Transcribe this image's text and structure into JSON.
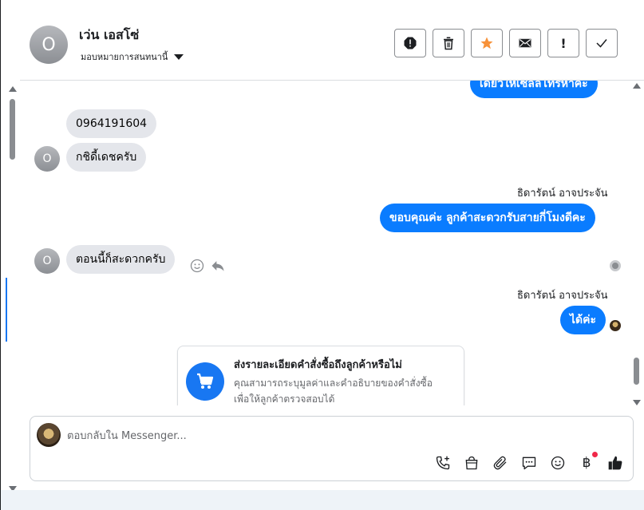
{
  "header": {
    "avatar_initial": "O",
    "name": "เว่น เอสโซ่",
    "assign_label": "มอบหมายการสนทนานี้"
  },
  "messages": {
    "top_cut": "เดี๋ยวให้เซลล์โทรหาค่ะ",
    "in_phone": "0964191604",
    "in_thanks": "กชิดี้เดชครับ",
    "agent_name_1": "ธิดารัตน์ อาจประจัน",
    "out_thanks": "ขอบคุณค่ะ ลูกค้าสะดวกรับสายกี่โมงดีคะ",
    "in_now": "ตอนนี้ก็สะดวกครับ",
    "agent_name_2": "ธิดารัตน์ อาจประจัน",
    "out_ok": "ได้ค่ะ",
    "avatar_initial": "O"
  },
  "order_card": {
    "title": "ส่งรายละเอียดคำสั่งซื้อถึงลูกค้าหรือไม่",
    "desc_line1": "คุณสามารถระบุมูลค่าและคำอธิบายของคำสั่งซื้อ",
    "desc_line2": "เพื่อให้ลูกค้าตรวจสอบได้"
  },
  "composer": {
    "placeholder": "ตอบกลับใน Messenger..."
  },
  "composer_tools": {
    "baht_symbol": "฿"
  },
  "colors": {
    "accent": "#0a7cff",
    "star": "#f7923a",
    "notify": "#f02849"
  }
}
